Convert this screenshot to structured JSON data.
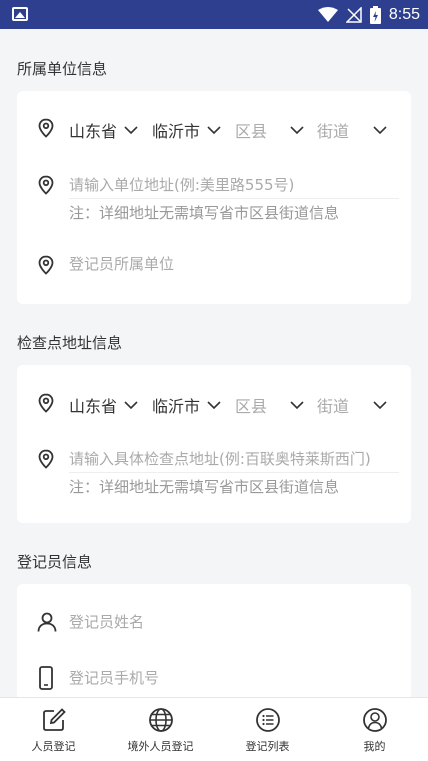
{
  "status_bar": {
    "time": "8:55"
  },
  "unit_section": {
    "title": "所属单位信息",
    "province": "山东省",
    "city": "临沂市",
    "district_placeholder": "区县",
    "street_placeholder": "街道",
    "address_placeholder": "请输入单位地址(例:美里路555号)",
    "note": "注：详细地址无需填写省市区县街道信息",
    "org_placeholder": "登记员所属单位"
  },
  "checkpoint_section": {
    "title": "检查点地址信息",
    "province": "山东省",
    "city": "临沂市",
    "district_placeholder": "区县",
    "street_placeholder": "街道",
    "address_placeholder": "请输入具体检查点地址(例:百联奥特莱斯西门)",
    "note": "注：详细地址无需填写省市区县街道信息"
  },
  "registrar_section": {
    "title": "登记员信息",
    "name_placeholder": "登记员姓名",
    "phone_placeholder": "登记员手机号"
  },
  "tabbar": {
    "items": [
      {
        "label": "人员登记",
        "icon": "edit-icon"
      },
      {
        "label": "境外人员登记",
        "icon": "globe-icon"
      },
      {
        "label": "登记列表",
        "icon": "list-icon"
      },
      {
        "label": "我的",
        "icon": "user-icon"
      }
    ]
  },
  "colors": {
    "status_bar": "#2f3f8f",
    "background": "#f4f5f7",
    "placeholder": "#aaaaaa"
  }
}
